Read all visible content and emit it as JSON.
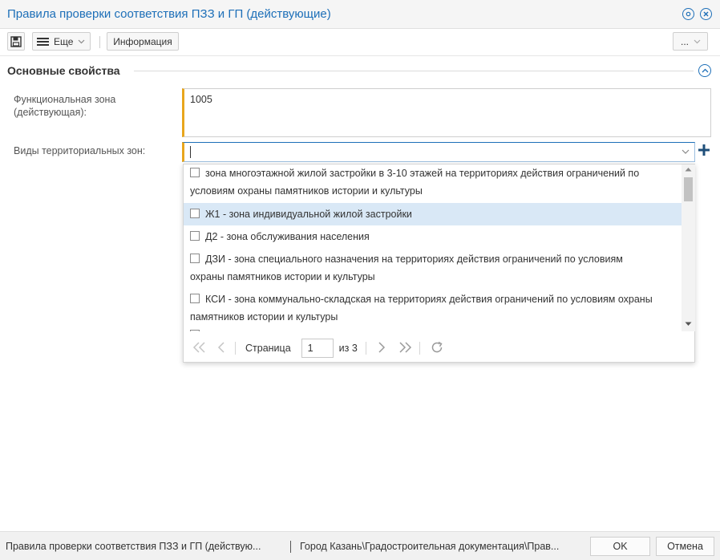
{
  "window": {
    "title": "Правила проверки соответствия ПЗЗ и ГП (действующие)"
  },
  "toolbar": {
    "save_icon": "save-icon",
    "more_label": "Еще",
    "info_label": "Информация",
    "ellipsis_label": "..."
  },
  "section": {
    "title": "Основные свойства"
  },
  "form": {
    "functional_zone_label": "Функциональная зона (действующая):",
    "functional_zone_value": "1005",
    "territorial_zones_label": "Виды территориальных зон:",
    "territorial_zones_value": ""
  },
  "dropdown": {
    "items": [
      {
        "line1": "зона многоэтажной жилой застройки в 3-10 этажей на территориях действия ограничений по",
        "line2": "условиям охраны памятников истории и культуры"
      },
      {
        "line1": "Ж1 - зона индивидуальной жилой застройки",
        "line2": ""
      },
      {
        "line1": "Д2 - зона обслуживания населения",
        "line2": ""
      },
      {
        "line1": "ДЗИ - зона специального назначения на территориях действия ограничений по условиям",
        "line2": "охраны памятников истории и культуры"
      },
      {
        "line1": "КСИ - зона коммунально-складская на территориях действия ограничений по условиям охраны",
        "line2": "памятников истории и культуры"
      }
    ],
    "pager": {
      "page_label": "Страница",
      "page_value": "1",
      "of_label": "из 3"
    }
  },
  "statusbar": {
    "left_text": "Правила проверки соответствия ПЗЗ и ГП (действую...",
    "path_text": "Город Казань\\Градостроительная документация\\Прав...",
    "ok_label": "OK",
    "cancel_label": "Отмена"
  },
  "colors": {
    "accent": "#1d6fb8",
    "required_marker": "#e8a61d",
    "highlight": "#d9e8f6"
  }
}
